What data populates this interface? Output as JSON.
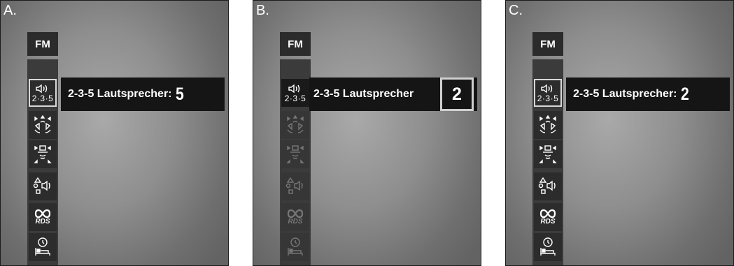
{
  "panels": [
    {
      "letter": "A.",
      "fm_label": "FM",
      "speaker_badge": "2·3·5",
      "rds_label": "RDS",
      "setting_label": "2-3-5 Lautsprecher:",
      "setting_value": "5"
    },
    {
      "letter": "B.",
      "fm_label": "FM",
      "speaker_badge": "2·3·5",
      "rds_label": "RDS",
      "setting_label": "2-3-5 Lautsprecher",
      "setting_value": "2"
    },
    {
      "letter": "C.",
      "fm_label": "FM",
      "speaker_badge": "2·3·5",
      "rds_label": "RDS",
      "setting_label": "2-3-5 Lautsprecher:",
      "setting_value": "2"
    }
  ],
  "menu_icons": [
    "speaker-235-icon",
    "surround-speakers-icon",
    "center-speaker-icon",
    "balance-shapes-speaker-icon",
    "rds-icon",
    "sleep-timer-icon"
  ],
  "colors": {
    "bar": "#151515",
    "menu_item": "#2c2c2c",
    "selected_border": "#d8d8d8"
  }
}
